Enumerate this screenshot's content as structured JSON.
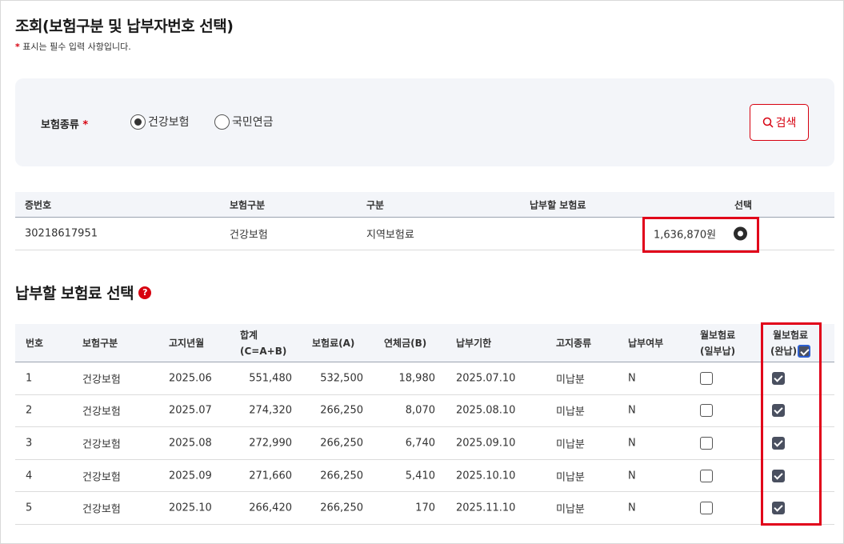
{
  "title": "조회(보험구분 및 납부자번호 선택)",
  "required_note": "표시는 필수 입력 사항입니다.",
  "required_star": "*",
  "search": {
    "label": "보험종류",
    "options": [
      "건강보험",
      "국민연금"
    ],
    "selected": "건강보험",
    "button_label": "검색"
  },
  "table1": {
    "headers": [
      "증번호",
      "보험구분",
      "구분",
      "납부할 보험료",
      "선택"
    ],
    "row": {
      "id": "30218617951",
      "type": "건강보험",
      "category": "지역보험료",
      "amount": "1,636,870원",
      "selected": true
    }
  },
  "section2": {
    "title": "납부할 보험료 선택",
    "help_icon": "question-icon"
  },
  "table2": {
    "headers": {
      "no": "번호",
      "type": "보험구분",
      "month": "고지년월",
      "total_1": "합계",
      "total_2": "(C=A+B)",
      "premium": "보험료(A)",
      "late": "연체금(B)",
      "due": "납부기한",
      "notice": "고지종류",
      "paid": "납부여부",
      "partial_1": "월보험료",
      "partial_2": "(일부납)",
      "full_1": "월보험료",
      "full_2": "(완납)"
    },
    "rows": [
      {
        "no": "1",
        "type": "건강보험",
        "month": "2025.06",
        "total": "551,480",
        "premium": "532,500",
        "late": "18,980",
        "due": "2025.07.10",
        "notice": "미납분",
        "paid": "N"
      },
      {
        "no": "2",
        "type": "건강보험",
        "month": "2025.07",
        "total": "274,320",
        "premium": "266,250",
        "late": "8,070",
        "due": "2025.08.10",
        "notice": "미납분",
        "paid": "N"
      },
      {
        "no": "3",
        "type": "건강보험",
        "month": "2025.08",
        "total": "272,990",
        "premium": "266,250",
        "late": "6,740",
        "due": "2025.09.10",
        "notice": "미납분",
        "paid": "N"
      },
      {
        "no": "4",
        "type": "건강보험",
        "month": "2025.09",
        "total": "271,660",
        "premium": "266,250",
        "late": "5,410",
        "due": "2025.10.10",
        "notice": "미납분",
        "paid": "N"
      },
      {
        "no": "5",
        "type": "건강보험",
        "month": "2025.10",
        "total": "266,420",
        "premium": "266,250",
        "late": "170",
        "due": "2025.11.10",
        "notice": "미납분",
        "paid": "N"
      }
    ]
  },
  "colors": {
    "accent": "#d7000f",
    "highlight": "#e1001a",
    "panel": "#f3f5f9"
  }
}
